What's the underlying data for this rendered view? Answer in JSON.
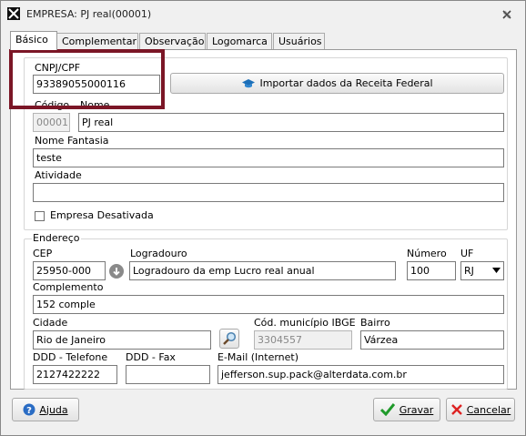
{
  "window": {
    "title": "EMPRESA: PJ real(00001)"
  },
  "tabs": [
    "Básico",
    "Complementar",
    "Observação",
    "Logomarca",
    "Usuários"
  ],
  "basic": {
    "cnpj_label": "CNPJ/CPF",
    "cnpj_value": "93389055000116",
    "import_button": "Importar dados da Receita Federal",
    "codigo_label": "Código",
    "codigo_value": "00001",
    "nome_label": "Nome",
    "nome_value": "PJ real",
    "fantasia_label": "Nome Fantasia",
    "fantasia_value": "teste",
    "atividade_label": "Atividade",
    "atividade_value": "",
    "desativada_label": "Empresa Desativada"
  },
  "address": {
    "legend": "Endereço",
    "cep_label": "CEP",
    "cep_value": "25950-000",
    "logradouro_label": "Logradouro",
    "logradouro_value": "Logradouro da emp Lucro real anual",
    "numero_label": "Número",
    "numero_value": "100",
    "uf_label": "UF",
    "uf_value": "RJ",
    "complemento_label": "Complemento",
    "complemento_value": "152 comple",
    "cidade_label": "Cidade",
    "cidade_value": "Rio de Janeiro",
    "cod_municipio_label": "Cód. município IBGE",
    "cod_municipio_value": "3304557",
    "bairro_label": "Bairro",
    "bairro_value": "Várzea",
    "ddd_tel_label": "DDD - Telefone",
    "ddd_tel_value": "2127422222",
    "ddd_fax_label": "DDD - Fax",
    "ddd_fax_value": "",
    "email_label": "E-Mail (Internet)",
    "email_value": "jefferson.sup.pack@alterdata.com.br"
  },
  "footer": {
    "help": "Ajuda",
    "save": "Gravar",
    "cancel": "Cancelar"
  },
  "colors": {
    "highlight": "#7b1626",
    "accent": "#1c6fb8"
  }
}
